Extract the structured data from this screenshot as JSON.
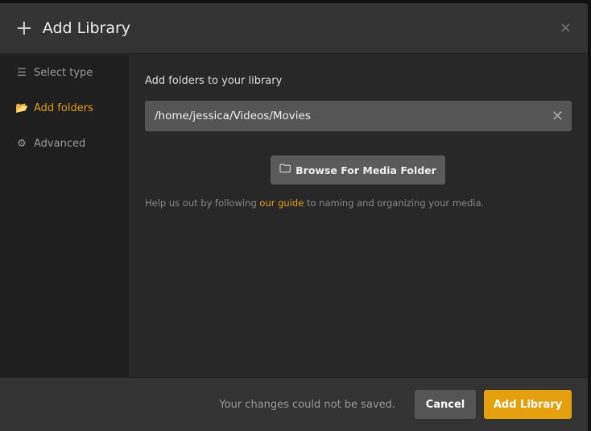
{
  "header": {
    "title": "Add Library",
    "close_label": "×"
  },
  "sidebar": {
    "items": [
      {
        "label": "Select type",
        "icon": "list-icon"
      },
      {
        "label": "Add folders",
        "icon": "folder-open-icon",
        "active": true
      },
      {
        "label": "Advanced",
        "icon": "gear-icon"
      }
    ]
  },
  "main": {
    "label": "Add folders to your library",
    "folder_value": "/home/jessica/Videos/Movies",
    "browse_label": "Browse For Media Folder",
    "help_pre": "Help us out by following ",
    "help_link": "our guide",
    "help_post": " to naming and organizing your media."
  },
  "footer": {
    "status": "Your changes could not be saved.",
    "cancel_label": "Cancel",
    "add_label": "Add Library"
  },
  "colors": {
    "accent": "#e5a00d"
  }
}
